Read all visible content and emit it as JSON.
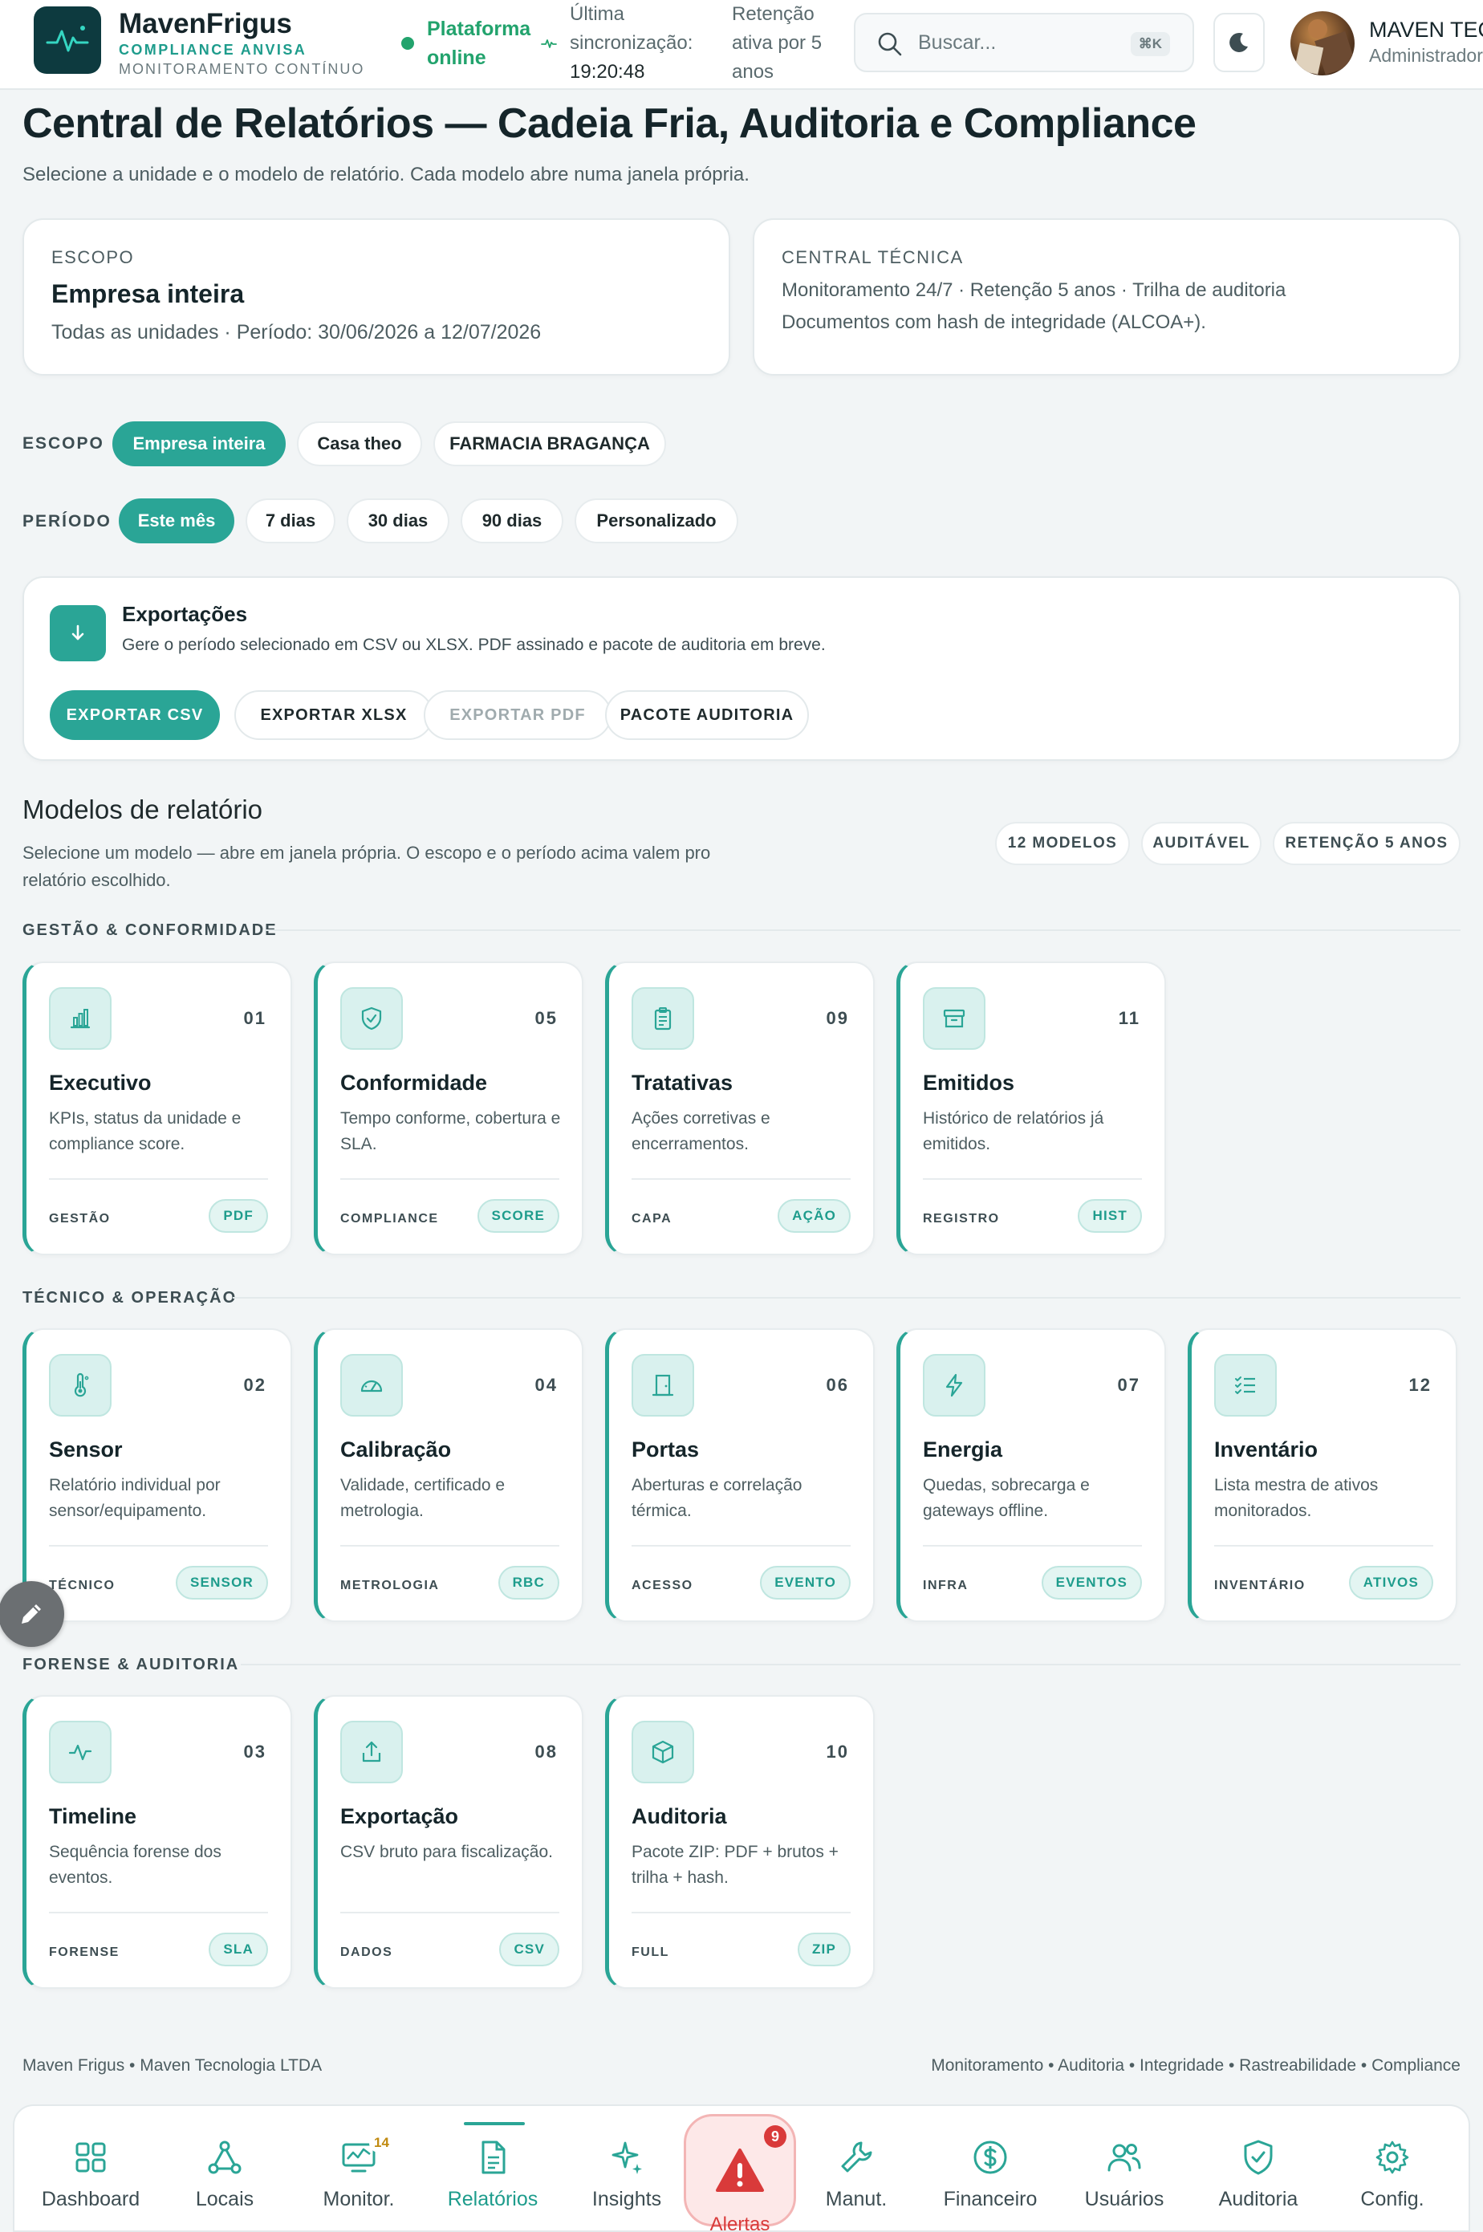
{
  "header": {
    "brand": "MavenFrigus",
    "brand_sub": "COMPLIANCE ANVISA",
    "brand_sub2": "MONITORAMENTO CONTÍNUO",
    "status": "Plataforma online",
    "sync_label": "Última sincronização:",
    "sync_time": "19:20:48",
    "retention": "Retenção ativa por 5 anos",
    "search_placeholder": "Buscar...",
    "search_shortcut": "⌘K",
    "user_name": "MAVEN TECNOLOGIA",
    "user_role": "Administrador"
  },
  "page": {
    "title": "Central de Relatórios — Cadeia Fria, Auditoria e Compliance",
    "subtitle": "Selecione a unidade e o modelo de relatório. Cada modelo abre numa janela própria."
  },
  "scope_card": {
    "label": "ESCOPO",
    "title": "Empresa inteira",
    "desc": "Todas as unidades · Período: 30/06/2026 a 12/07/2026"
  },
  "tech_card": {
    "label": "CENTRAL TÉCNICA",
    "line1": "Monitoramento 24/7 · Retenção 5 anos · Trilha de auditoria",
    "line2": "Documentos com hash de integridade (ALCOA+)."
  },
  "filters": {
    "scope_label": "ESCOPO",
    "scope_options": [
      "Empresa inteira",
      "Casa theo",
      "FARMACIA BRAGANÇA"
    ],
    "scope_selected": "Empresa inteira",
    "period_label": "PERÍODO",
    "period_options": [
      "Este mês",
      "7 dias",
      "30 dias",
      "90 dias",
      "Personalizado"
    ],
    "period_selected": "Este mês"
  },
  "exports": {
    "title": "Exportações",
    "desc": "Gere o período selecionado em CSV ou XLSX. PDF assinado e pacote de auditoria em breve.",
    "buttons": [
      "EXPORTAR CSV",
      "EXPORTAR XLSX",
      "EXPORTAR PDF",
      "PACOTE AUDITORIA"
    ]
  },
  "models": {
    "title": "Modelos de relatório",
    "desc": "Selecione um modelo — abre em janela própria. O escopo e o período acima valem pro relatório escolhido.",
    "tags": [
      "12 MODELOS",
      "AUDITÁVEL",
      "RETENÇÃO 5 ANOS"
    ],
    "groups": [
      {
        "label": "GESTÃO & CONFORMIDADE",
        "cards": [
          {
            "num": "01",
            "title": "Executivo",
            "desc": "KPIs, status da unidade e compliance score.",
            "cat": "GESTÃO",
            "badge": "PDF",
            "icon": "bar-chart-icon"
          },
          {
            "num": "05",
            "title": "Conformidade",
            "desc": "Tempo conforme, cobertura e SLA.",
            "cat": "COMPLIANCE",
            "badge": "SCORE",
            "icon": "shield-check-icon"
          },
          {
            "num": "09",
            "title": "Tratativas",
            "desc": "Ações corretivas e encerramentos.",
            "cat": "CAPA",
            "badge": "AÇÃO",
            "icon": "clipboard-icon"
          },
          {
            "num": "11",
            "title": "Emitidos",
            "desc": "Histórico de relatórios já emitidos.",
            "cat": "REGISTRO",
            "badge": "HIST",
            "icon": "archive-icon"
          }
        ]
      },
      {
        "label": "TÉCNICO & OPERAÇÃO",
        "cards": [
          {
            "num": "02",
            "title": "Sensor",
            "desc": "Relatório individual por sensor/equipamento.",
            "cat": "TÉCNICO",
            "badge": "SENSOR",
            "icon": "thermometer-icon"
          },
          {
            "num": "04",
            "title": "Calibração",
            "desc": "Validade, certificado e metrologia.",
            "cat": "METROLOGIA",
            "badge": "RBC",
            "icon": "gauge-icon"
          },
          {
            "num": "06",
            "title": "Portas",
            "desc": "Aberturas e correlação térmica.",
            "cat": "ACESSO",
            "badge": "EVENTO",
            "icon": "door-icon"
          },
          {
            "num": "07",
            "title": "Energia",
            "desc": "Quedas, sobrecarga e gateways offline.",
            "cat": "INFRA",
            "badge": "EVENTOS",
            "icon": "lightning-icon"
          },
          {
            "num": "12",
            "title": "Inventário",
            "desc": "Lista mestra de ativos monitorados.",
            "cat": "INVENTÁRIO",
            "badge": "ATIVOS",
            "icon": "checklist-icon"
          }
        ]
      },
      {
        "label": "FORENSE & AUDITORIA",
        "cards": [
          {
            "num": "03",
            "title": "Timeline",
            "desc": "Sequência forense dos eventos.",
            "cat": "FORENSE",
            "badge": "SLA",
            "icon": "pulse-icon"
          },
          {
            "num": "08",
            "title": "Exportação",
            "desc": "CSV bruto para fiscalização.",
            "cat": "DADOS",
            "badge": "CSV",
            "icon": "upload-icon"
          },
          {
            "num": "10",
            "title": "Auditoria",
            "desc": "Pacote ZIP: PDF + brutos + trilha + hash.",
            "cat": "FULL",
            "badge": "ZIP",
            "icon": "package-icon"
          }
        ]
      }
    ]
  },
  "footer": {
    "left": "Maven Frigus • Maven Tecnologia LTDA",
    "right": "Monitoramento • Auditoria • Integridade • Rastreabilidade • Compliance"
  },
  "nav": {
    "items": [
      {
        "label": "Dashboard",
        "icon": "grid-icon"
      },
      {
        "label": "Locais",
        "icon": "network-icon"
      },
      {
        "label": "Monitor.",
        "icon": "monitor-icon",
        "badge": "14"
      },
      {
        "label": "Relatórios",
        "icon": "document-icon",
        "active": true
      },
      {
        "label": "Insights",
        "icon": "sparkle-icon"
      },
      {
        "label": "Manut.",
        "icon": "wrench-icon"
      },
      {
        "label": "Financeiro",
        "icon": "dollar-icon"
      },
      {
        "label": "Usuários",
        "icon": "users-icon"
      },
      {
        "label": "Auditoria",
        "icon": "shield-check-icon"
      },
      {
        "label": "Config.",
        "icon": "gear-icon"
      }
    ],
    "alerts_label": "Alertas",
    "alerts_badge": "9"
  },
  "colors": {
    "accent": "#2aa596",
    "accent_text": "#1e9c8c",
    "online": "#22a36d",
    "alert": "#d93a3a",
    "background": "#f2f5f6"
  }
}
